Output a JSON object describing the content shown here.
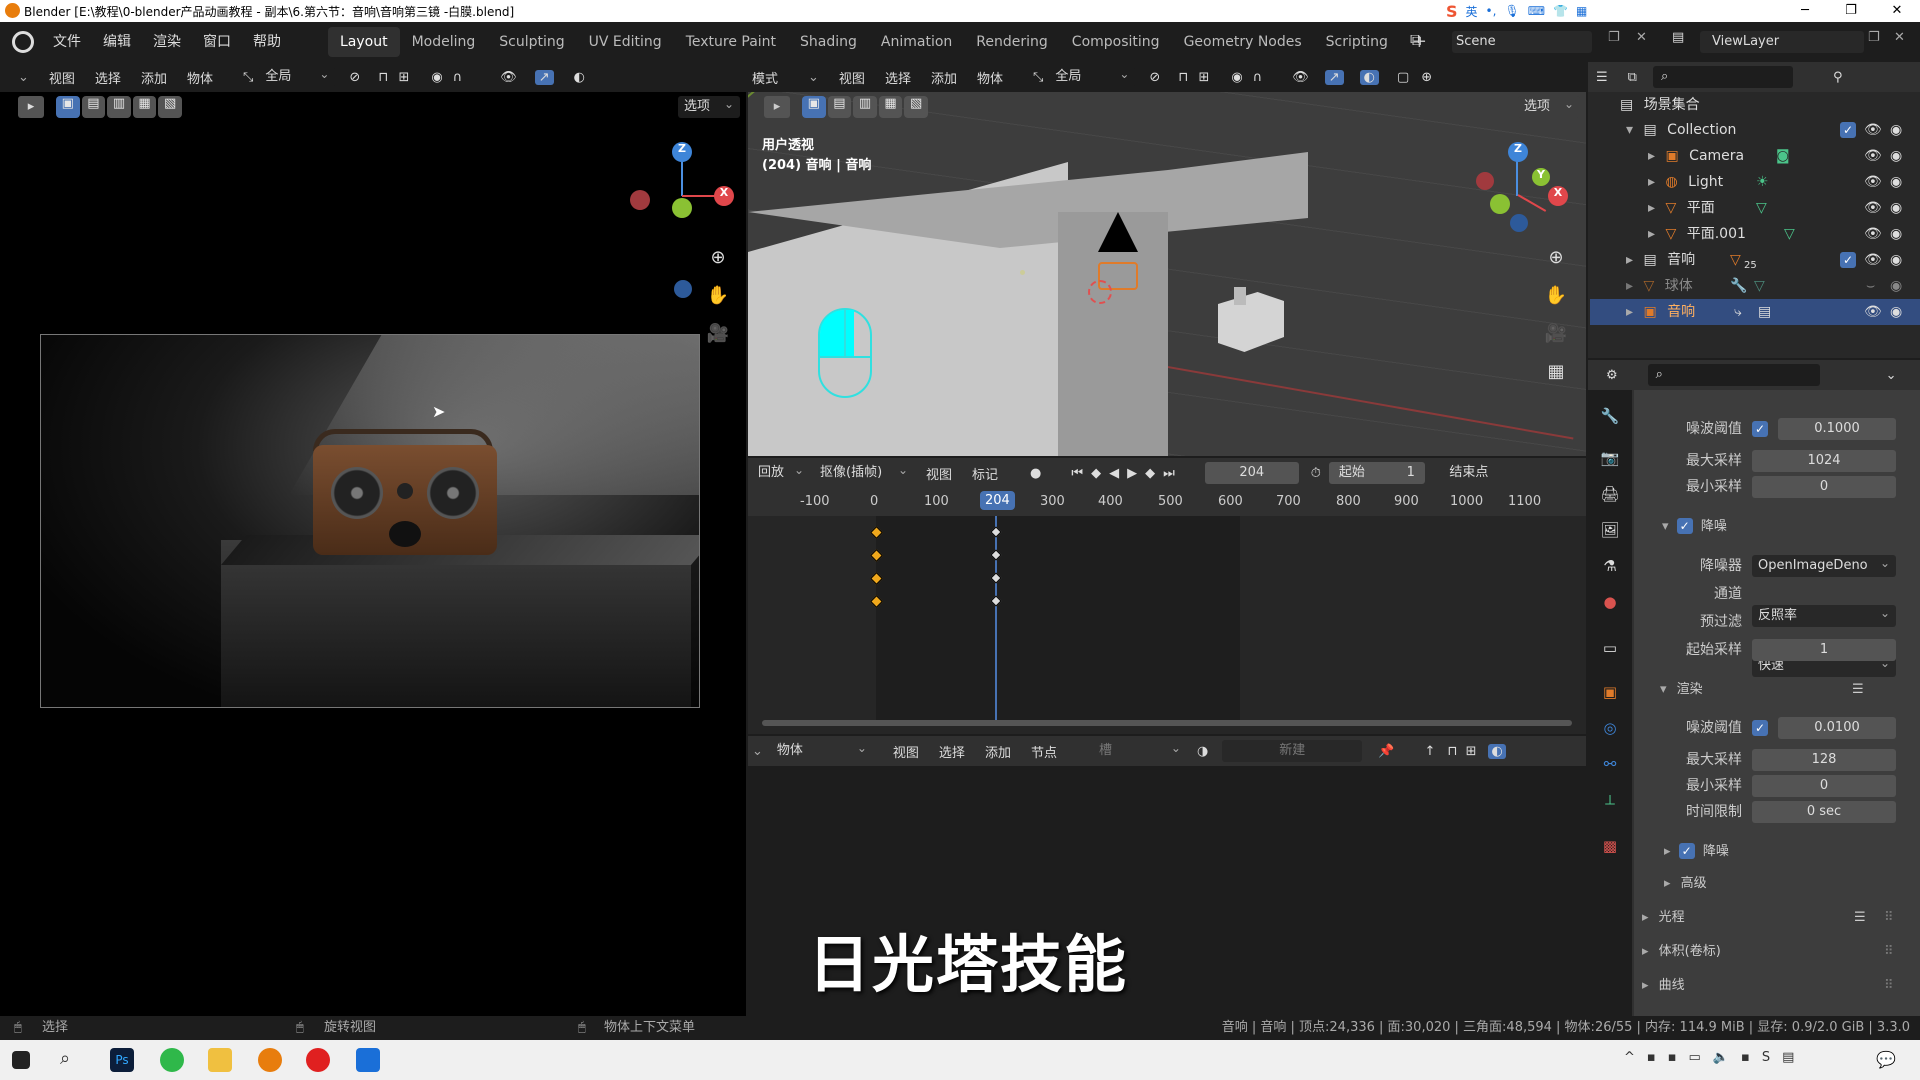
{
  "title_bar": {
    "title": "Blender [E:\\教程\\0-blender产品动画教程 - 副本\\6.第六节：音响\\音响第三镜 -白膜.blend]",
    "ime": "英",
    "minimize": "─",
    "maximize": "❐",
    "close": "✕"
  },
  "menu": {
    "items": [
      "文件",
      "编辑",
      "渲染",
      "窗口",
      "帮助"
    ],
    "workspaces": [
      "Layout",
      "Modeling",
      "Sculpting",
      "UV Editing",
      "Texture Paint",
      "Shading",
      "Animation",
      "Rendering",
      "Compositing",
      "Geometry Nodes",
      "Scripting"
    ],
    "active_workspace": "Layout",
    "add_tab": "+",
    "scene": "Scene",
    "view_layer": "ViewLayer"
  },
  "camera_view": {
    "header": [
      "视图",
      "选择",
      "添加",
      "物体"
    ],
    "transform": "全局",
    "options": "选项"
  },
  "viewport3d": {
    "mode": "模式",
    "header": [
      "视图",
      "选择",
      "添加",
      "物体"
    ],
    "transform": "全局",
    "options": "选项",
    "overlay_title": "用户透视",
    "overlay_sub": "(204) 音响 | 音响"
  },
  "gizmo": {
    "z": "Z",
    "x": "X",
    "y": "Y"
  },
  "timeline": {
    "playback": "回放",
    "keying": "抠像(插帧)",
    "view": "视图",
    "marker": "标记",
    "current_frame": "204",
    "start_label": "起始",
    "start_value": "1",
    "end_label": "结束点",
    "ruler": [
      "-100",
      "0",
      "100",
      "204",
      "300",
      "400",
      "500",
      "600",
      "700",
      "800",
      "900",
      "1000",
      "1100"
    ],
    "keyframes": [
      0,
      204
    ]
  },
  "node_editor": {
    "type": "物体",
    "menus": [
      "视图",
      "选择",
      "添加",
      "节点"
    ],
    "slot": "槽",
    "new": "新建"
  },
  "subtitle": "日光塔技能",
  "outliner": {
    "root": "场景集合",
    "rows": [
      {
        "name": "Collection",
        "level": 1,
        "type": "collection"
      },
      {
        "name": "Camera",
        "level": 2,
        "type": "camera"
      },
      {
        "name": "Light",
        "level": 2,
        "type": "light"
      },
      {
        "name": "平面",
        "level": 2,
        "type": "mesh"
      },
      {
        "name": "平面.001",
        "level": 2,
        "type": "mesh"
      },
      {
        "name": "音响",
        "level": 1,
        "type": "collection",
        "badge": "25"
      },
      {
        "name": "球体",
        "level": 1,
        "type": "mesh-dim"
      },
      {
        "name": "音响",
        "level": 1,
        "type": "object-selected"
      }
    ]
  },
  "properties": {
    "viewport_noise_label": "噪波阈值",
    "viewport_noise": "0.1000",
    "viewport_max_label": "最大采样",
    "viewport_max": "1024",
    "viewport_min_label": "最小采样",
    "viewport_min": "0",
    "denoise_label": "降噪",
    "denoiser_label": "降噪器",
    "denoiser": "OpenImageDeno",
    "passes_label": "通道",
    "passes": "反照率",
    "prefilter_label": "预过滤",
    "prefilter": "快速",
    "start_sample_label": "起始采样",
    "start_sample": "1",
    "render_label": "渲染",
    "render_noise_label": "噪波阈值",
    "render_noise": "0.0100",
    "render_max_label": "最大采样",
    "render_max": "128",
    "render_min_label": "最小采样",
    "render_min": "0",
    "time_limit_label": "时间限制",
    "time_limit": "0 sec",
    "render_denoise_label": "降噪",
    "advanced_label": "高级",
    "light_paths": "光程",
    "volumes": "体积(卷标)",
    "curves": "曲线"
  },
  "statusbar": {
    "select": "选择",
    "rotate": "旋转视图",
    "context": "物体上下文菜单",
    "stats": "音响 | 音响 | 顶点:24,336 | 面:30,020 | 三角面:48,594 | 物体:26/55 | 内存: 114.9 MiB | 显存: 0.9/2.0 GiB | 3.3.0"
  }
}
